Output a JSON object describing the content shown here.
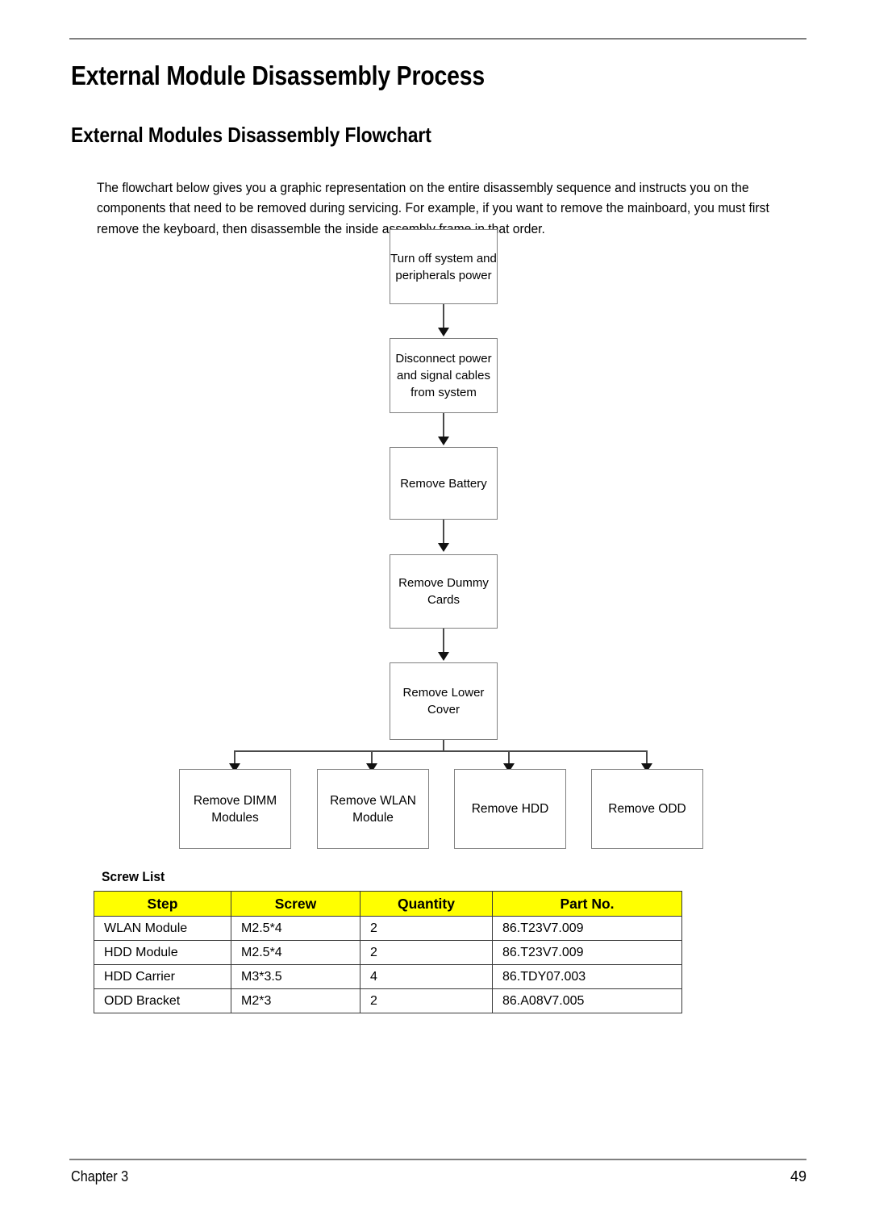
{
  "page": {
    "title": "External Module Disassembly Process",
    "subtitle": "External Modules Disassembly Flowchart",
    "intro": "The flowchart below gives you a graphic representation on the entire disassembly sequence and instructs you on the components that need to be removed during servicing. For example, if you want to remove the mainboard, you must first remove the keyboard, then disassemble the inside assembly frame in that order."
  },
  "flowchart": {
    "main_steps": [
      {
        "label": "Turn off system and peripherals power"
      },
      {
        "label": "Disconnect power and signal cables from system"
      },
      {
        "label": "Remove Battery"
      },
      {
        "label": "Remove Dummy Cards"
      },
      {
        "label": "Remove Lower Cover"
      }
    ],
    "branch_steps": [
      {
        "label": "Remove DIMM Modules"
      },
      {
        "label": "Remove WLAN Module"
      },
      {
        "label": "Remove HDD"
      },
      {
        "label": "Remove ODD"
      }
    ]
  },
  "screw_list": {
    "label": "Screw List",
    "header_color": "#ffff00",
    "columns": [
      "Step",
      "Screw",
      "Quantity",
      "Part No."
    ],
    "rows": [
      {
        "step": "WLAN Module",
        "screw": "M2.5*4",
        "quantity": "2",
        "part_no": "86.T23V7.009"
      },
      {
        "step": "HDD Module",
        "screw": "M2.5*4",
        "quantity": "2",
        "part_no": "86.T23V7.009"
      },
      {
        "step": "HDD Carrier",
        "screw": "M3*3.5",
        "quantity": "4",
        "part_no": "86.TDY07.003"
      },
      {
        "step": "ODD Bracket",
        "screw": "M2*3",
        "quantity": "2",
        "part_no": "86.A08V7.005"
      }
    ]
  },
  "footer": {
    "chapter": "Chapter 3",
    "page_number": "49"
  }
}
